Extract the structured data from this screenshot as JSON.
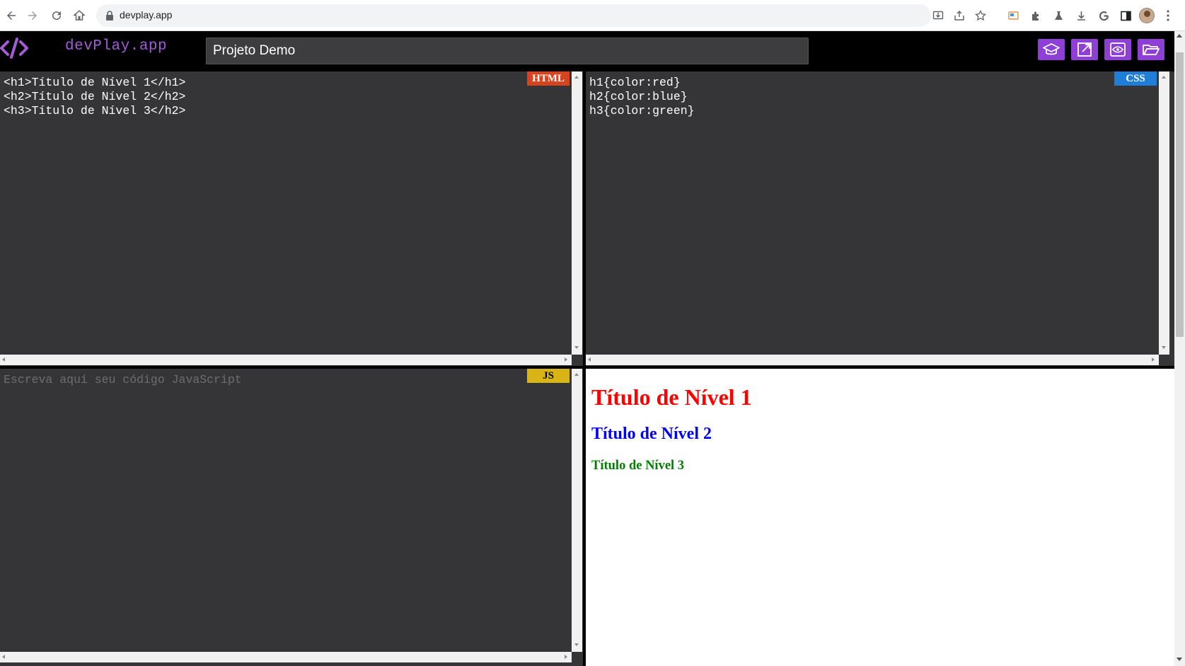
{
  "browser": {
    "url": "devplay.app",
    "nav_icons": [
      "back-icon",
      "forward-icon",
      "reload-icon",
      "home-icon"
    ],
    "omnibox_icons": [
      "install-app-icon",
      "share-icon",
      "bookmark-star-icon"
    ],
    "extension_icons": [
      "cast-icon",
      "extensions-puzzle-icon",
      "lab-flask-icon",
      "download-icon",
      "google-icon",
      "side-panel-icon"
    ]
  },
  "header": {
    "logo_text": "devPlay.app",
    "project_name": "Projeto Demo",
    "buttons": [
      "learn-button",
      "open-external-button",
      "preview-button",
      "open-folder-button"
    ],
    "accent_color": "#8e3fd6",
    "logo_color": "#a35bd6"
  },
  "editors": {
    "html": {
      "badge": "HTML",
      "badge_color": "#d8431f",
      "lines": [
        "<h1>Título de Nível 1</h1>",
        "<h2>Título de Nível 2</h2>",
        "<h3>Título de Nível 3</h2>"
      ]
    },
    "css": {
      "badge": "CSS",
      "badge_color": "#1f7ed8",
      "lines": [
        "h1{color:red}",
        "h2{color:blue}",
        "h3{color:green}"
      ]
    },
    "js": {
      "badge": "JS",
      "badge_color": "#d8b416",
      "placeholder": "Escreva aqui seu código JavaScript"
    }
  },
  "preview": {
    "h1": "Título de Nível 1",
    "h2": "Título de Nível 2",
    "h3": "Título de Nível 3"
  }
}
